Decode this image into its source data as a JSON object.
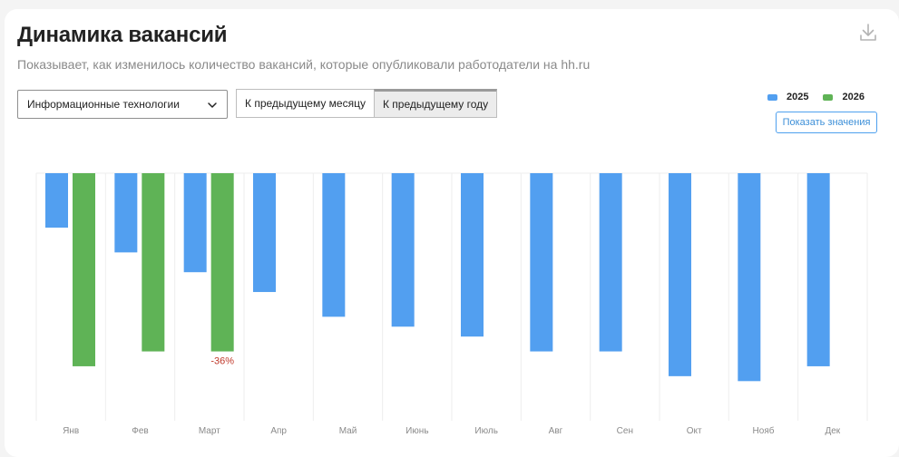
{
  "header": {
    "title": "Динамика вакансий",
    "subtitle": "Показывает, как изменилось количество вакансий, которые опубликовали работодатели на hh.ru",
    "download_icon": "download-icon"
  },
  "filters": {
    "industry_select_value": "Информационные технологии",
    "toggle_prev_month_label": "К предыдущему месяцу",
    "toggle_prev_year_label": "К предыдущему году",
    "active_toggle": "prev_year"
  },
  "legend": {
    "items": [
      {
        "label": "2025",
        "color": "#529ff0"
      },
      {
        "label": "2026",
        "color": "#5fb356"
      }
    ]
  },
  "show_values_label": "Показать значения",
  "chart_data": {
    "type": "bar",
    "categories": [
      "Янв",
      "Фев",
      "Март",
      "Апр",
      "Май",
      "Июнь",
      "Июль",
      "Авг",
      "Сен",
      "Окт",
      "Нояб",
      "Дек"
    ],
    "series": [
      {
        "name": "2025",
        "color": "#529ff0",
        "values": [
          -11,
          -16,
          -20,
          -24,
          -29,
          -31,
          -33,
          -36,
          -36,
          -41,
          -42,
          -39
        ]
      },
      {
        "name": "2026",
        "color": "#5fb356",
        "values": [
          -39,
          -36,
          -36,
          null,
          null,
          null,
          null,
          null,
          null,
          null,
          null,
          null
        ]
      }
    ],
    "annotations": [
      {
        "category": "Март",
        "series": "2026",
        "text": "-36%",
        "color": "#c0392b"
      }
    ],
    "ylim": [
      -50,
      0
    ],
    "grid": true,
    "legend_position": "top-right"
  }
}
